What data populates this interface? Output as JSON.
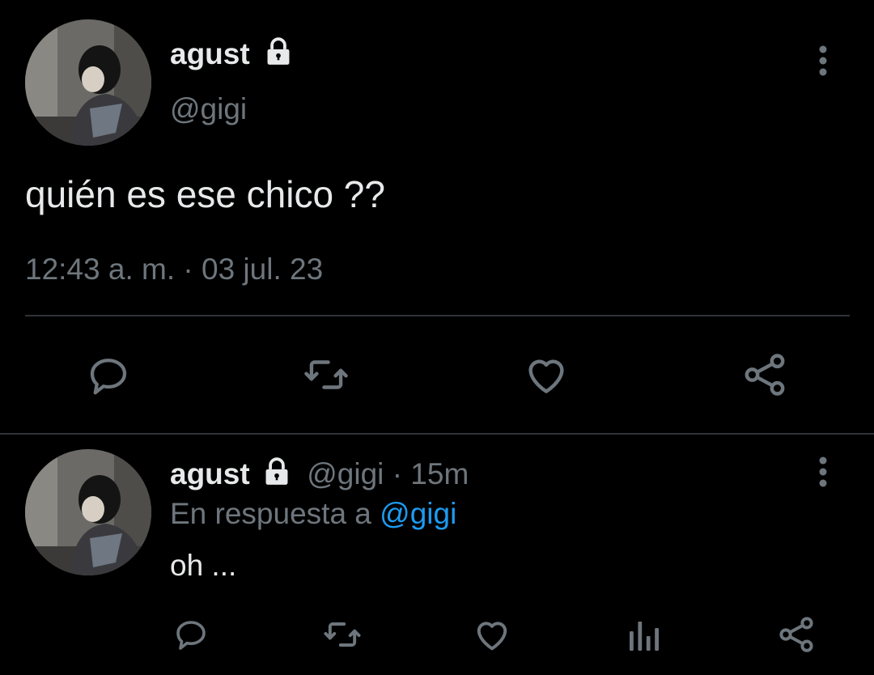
{
  "main_tweet": {
    "display_name": "agust",
    "handle": "@gigi",
    "text": "quién es ese chico ??",
    "timestamp": "12:43 a. m. · 03 jul. 23",
    "icons": {
      "reply": "reply-icon",
      "retweet": "retweet-icon",
      "like": "heart-icon",
      "share": "share-icon",
      "more": "more-vertical-icon",
      "lock": "lock-icon"
    }
  },
  "reply_tweet": {
    "display_name": "agust",
    "handle": "@gigi",
    "separator": "·",
    "time_ago": "15m",
    "reply_prefix": "En respuesta a",
    "reply_to": "@gigi",
    "text": "oh ...",
    "icons": {
      "reply": "reply-icon",
      "retweet": "retweet-icon",
      "like": "heart-icon",
      "analytics": "analytics-icon",
      "share": "share-icon",
      "more": "more-vertical-icon",
      "lock": "lock-icon"
    }
  },
  "colors": {
    "background": "#000000",
    "text": "#e7e9ea",
    "muted": "#6e767d",
    "link": "#1d9bf0",
    "divider": "#2f3336"
  }
}
